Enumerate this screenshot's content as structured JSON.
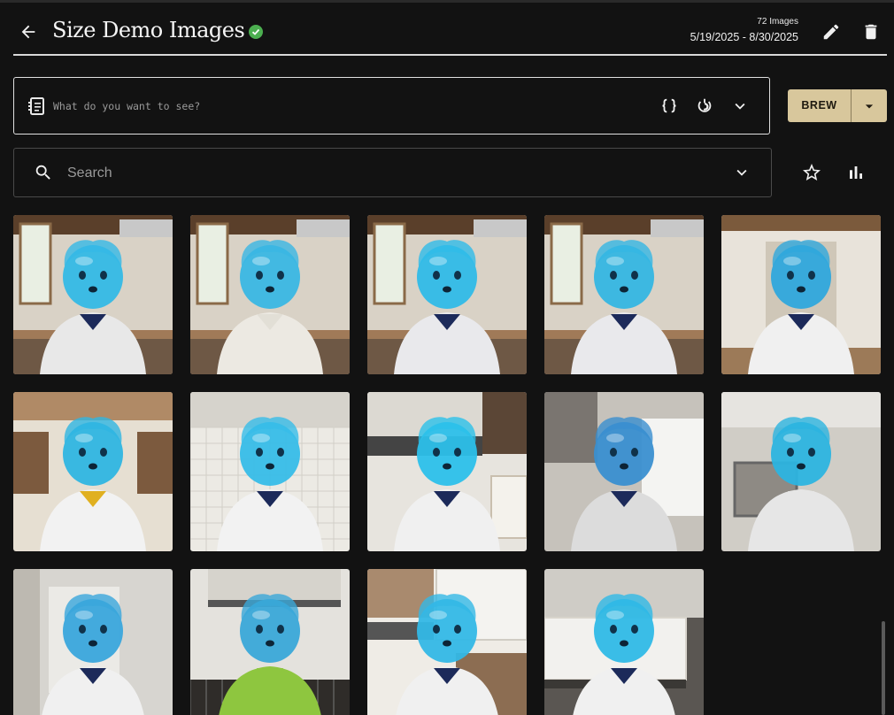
{
  "header": {
    "title": "Size Demo Images",
    "image_count": "72 Images",
    "date_range": "5/19/2025 - 8/30/2025",
    "verified_color": "#4caf50"
  },
  "icons": {
    "back": "arrow-left-icon",
    "verified": "check-circle-icon",
    "edit": "pencil-icon",
    "delete": "trash-icon",
    "prompt": "notepad-icon",
    "braces": "curly-braces-icon",
    "swirl": "swirl-icon",
    "chevron": "chevron-down-icon",
    "search": "search-icon",
    "star": "star-outline-icon",
    "chart": "bar-chart-icon"
  },
  "prompt": {
    "placeholder": "What do you want to see?",
    "value": ""
  },
  "brew": {
    "label": "BREW",
    "color": "#d8c79c"
  },
  "search": {
    "placeholder": "Search",
    "value": ""
  },
  "gallery": {
    "images": [
      {
        "scene": "kitchen-window",
        "shirt": "#e8e8e8",
        "collar": "#1c2a5a",
        "body": "#34b9e6"
      },
      {
        "scene": "kitchen-window",
        "shirt": "#ece9e2",
        "collar": "#e2dfd6",
        "body": "#3ab7e4"
      },
      {
        "scene": "kitchen-window",
        "shirt": "#e9e9ec",
        "collar": "#1c2a5a",
        "body": "#30bbe8"
      },
      {
        "scene": "kitchen-window",
        "shirt": "#e9e9ec",
        "collar": "#1c2a5a",
        "body": "#35b6e3"
      },
      {
        "scene": "kitchen-door",
        "shirt": "#f0f0f0",
        "collar": "#1c2a5a",
        "body": "#2fa8dc"
      },
      {
        "scene": "cabinets",
        "shirt": "#f2f2f2",
        "collar": "#e0b020",
        "body": "#2fb5e2"
      },
      {
        "scene": "tiles",
        "shirt": "#f2f2f2",
        "collar": "#1c2a5a",
        "body": "#37bde8"
      },
      {
        "scene": "hood",
        "shirt": "#f0f0f0",
        "collar": "#1c2a5a",
        "body": "#2cc0ea"
      },
      {
        "scene": "bright-window",
        "shirt": "#dcdcdc",
        "collar": "#1c2a5a",
        "body": "#3a8fd0"
      },
      {
        "scene": "oven",
        "shirt": "#e6e6e6",
        "collar": "#e6e6e6",
        "body": "#2cb4e0"
      },
      {
        "scene": "doorway",
        "shirt": "#f0f0f0",
        "collar": "#1c2a5a",
        "body": "#3aa6dc"
      },
      {
        "scene": "hood-grill",
        "shirt": "#8ec63f",
        "collar": "#8ec63f",
        "body": "#3aa8d8"
      },
      {
        "scene": "cabinets-wood",
        "shirt": "#f0f0f0",
        "collar": "#1c2a5a",
        "body": "#33b8e6"
      },
      {
        "scene": "cabinets-white",
        "shirt": "#f0f0f0",
        "collar": "#1c2a5a",
        "body": "#2fb9e6"
      }
    ]
  }
}
